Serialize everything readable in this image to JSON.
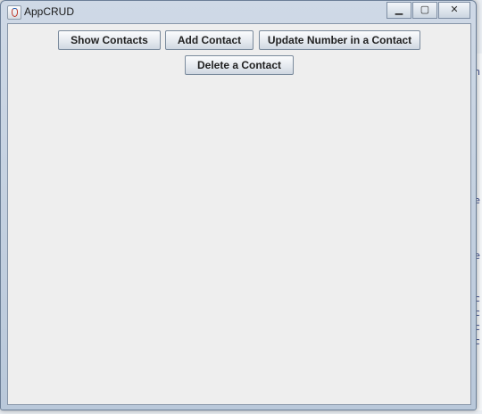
{
  "window": {
    "title": "AppCRUD",
    "controls": {
      "minimize": "▁",
      "maximize": "▢",
      "close": "✕"
    }
  },
  "toolbar": {
    "show_contacts": "Show Contacts",
    "add_contact": "Add Contact",
    "update_number": "Update Number in a Contact",
    "delete_contact": "Delete a Contact"
  },
  "background_fragments": [
    "n",
    "e",
    "e",
    "c",
    "c",
    "c",
    "c"
  ]
}
